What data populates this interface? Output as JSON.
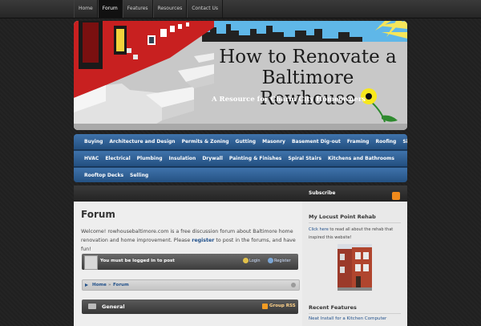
{
  "topnav": {
    "items": [
      {
        "label": "Home",
        "active": false
      },
      {
        "label": "Forum",
        "active": true
      },
      {
        "label": "Features",
        "active": false
      },
      {
        "label": "Resources",
        "active": false
      },
      {
        "label": "Contact Us",
        "active": false
      }
    ]
  },
  "banner": {
    "title_line1": "How to Renovate a",
    "title_line2": "Baltimore Rowhouse",
    "subtitle": "A Resource for  Charm City Homeowners"
  },
  "categories": {
    "row1": [
      "Buying",
      "Architecture and Design",
      "Permits & Zoning",
      "Gutting",
      "Masonry",
      "Basement Dig-out",
      "Framing",
      "Roofing",
      "Siding"
    ],
    "row2": [
      "HVAC",
      "Electrical",
      "Plumbing",
      "Insulation",
      "Drywall",
      "Painting & Finishes",
      "Spiral Stairs",
      "Kitchens and Bathrooms"
    ],
    "row3": [
      "Rooftop Decks",
      "Selling"
    ]
  },
  "main": {
    "title": "Forum",
    "intro_part1": "Welcome! rowhousebaltimore.com is a free discussion forum about Baltimore home renovation and home improvement. Please ",
    "intro_link": "register",
    "intro_part2": " to post in the forums, and have fun!",
    "login_notice": "You must be logged in to post",
    "login_link": "Login",
    "register_link": "Register",
    "breadcrumb": {
      "home": "Home",
      "separator": "»",
      "current": "Forum"
    },
    "forum_group": {
      "title": "General",
      "rss_label": "Group RSS"
    }
  },
  "sidebar": {
    "subscribe_label": "Subscribe",
    "widget1_title": "My Locust Point Rehab",
    "widget1_link": "Click here",
    "widget1_text": " to read all about the rehab that inspired this website!",
    "widget2_title": "Recent Features",
    "widget2_item": "Neat Install for a Kitchen Computer"
  },
  "colors": {
    "page_bg": "#202020",
    "category_bar": "#2c5b8e",
    "link": "#1f4f8a",
    "rss": "#f08a1c"
  }
}
